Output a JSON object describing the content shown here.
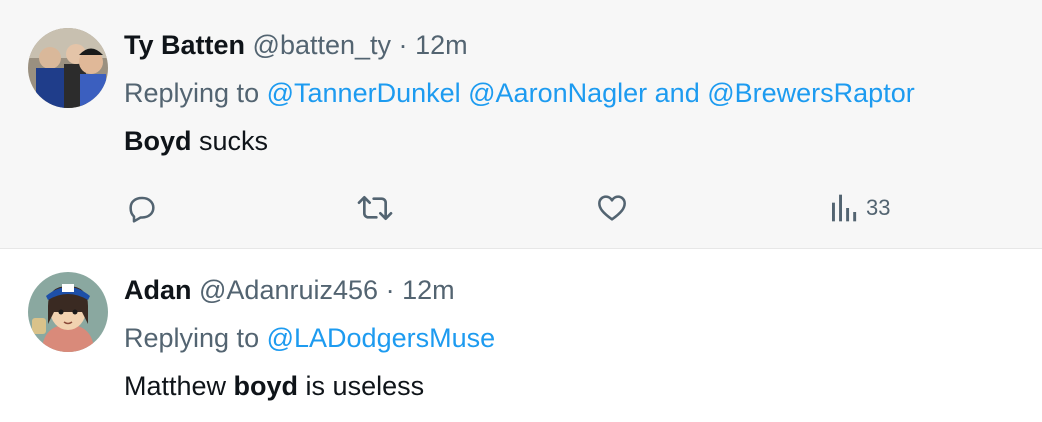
{
  "tweets": [
    {
      "name": "Ty Batten",
      "handle": "@batten_ty",
      "separator": "·",
      "time": "12m",
      "replying_prefix": "Replying to",
      "mentions": [
        "@TannerDunkel",
        "@AaronNagler",
        "@BrewersRaptor"
      ],
      "mention_joiner": "and",
      "body": {
        "bold": "Boyd",
        "rest": " sucks"
      },
      "actions": {
        "reply_icon": "reply-icon",
        "retweet_icon": "retweet-icon",
        "like_icon": "heart-icon",
        "views_icon": "views-icon",
        "views_count": "33"
      }
    },
    {
      "name": "Adan",
      "handle": "@Adanruiz456",
      "separator": "·",
      "time": "12m",
      "replying_prefix": "Replying to",
      "mentions": [
        "@LADodgersMuse"
      ],
      "body": {
        "before": "Matthew ",
        "bold": "boyd",
        "after": " is useless"
      }
    }
  ],
  "colors": {
    "link": "#1d9bf0",
    "secondary_text": "#536471",
    "primary_text": "#0f1419",
    "highlight_bg": "#f7f7f7"
  }
}
